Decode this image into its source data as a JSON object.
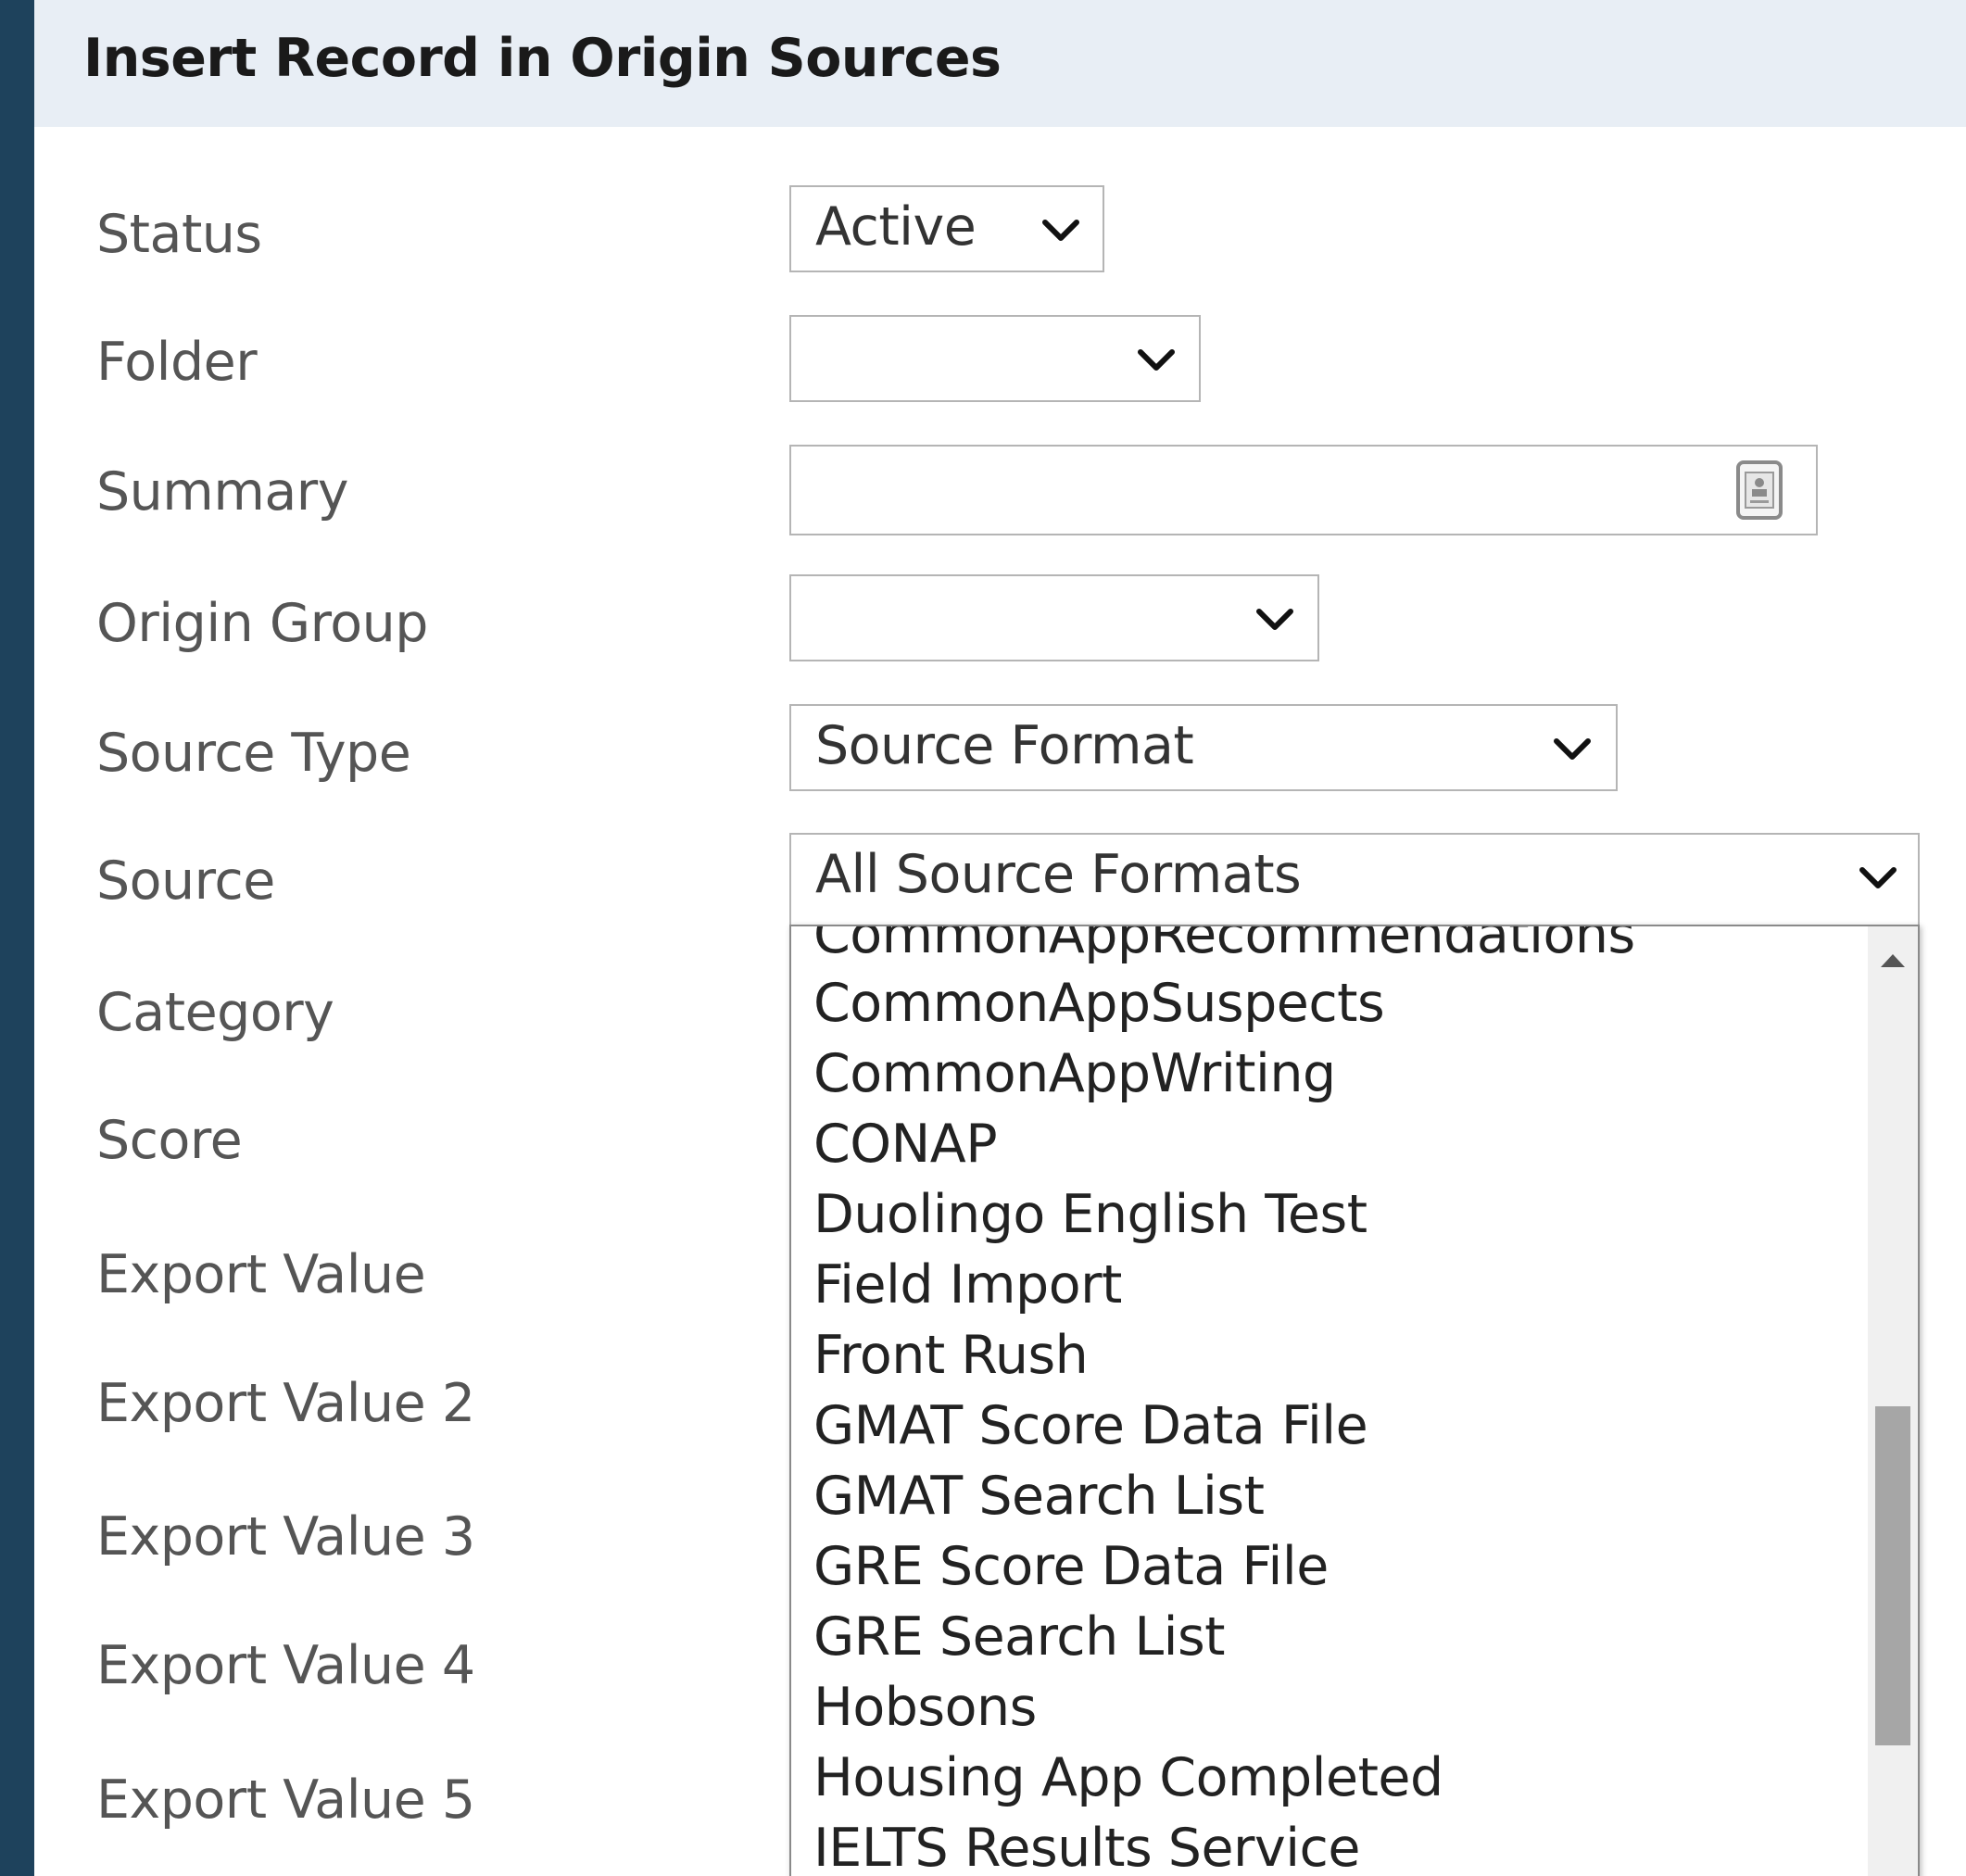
{
  "dialog": {
    "title": "Insert Record in Origin Sources"
  },
  "fields": {
    "status": {
      "label": "Status",
      "value": "Active"
    },
    "folder": {
      "label": "Folder",
      "value": ""
    },
    "summary": {
      "label": "Summary",
      "value": ""
    },
    "origin_group": {
      "label": "Origin Group",
      "value": ""
    },
    "source_type": {
      "label": "Source Type",
      "value": "Source Format"
    },
    "source": {
      "label": "Source",
      "value": "All Source Formats"
    },
    "category": {
      "label": "Category"
    },
    "score": {
      "label": "Score"
    },
    "export_value": {
      "label": "Export Value"
    },
    "export_value_2": {
      "label": "Export Value 2"
    },
    "export_value_3": {
      "label": "Export Value 3"
    },
    "export_value_4": {
      "label": "Export Value 4"
    },
    "export_value_5": {
      "label": "Export Value 5"
    }
  },
  "source_options": [
    "CommonAppRecommendations",
    "CommonAppSuspects",
    "CommonAppWriting",
    "CONAP",
    "Duolingo English Test",
    "Field Import",
    "Front Rush",
    "GMAT Score Data File",
    "GMAT Search List",
    "GRE Score Data File",
    "GRE Search List",
    "Hobsons",
    "Housing App Completed",
    "IELTS Results Service"
  ],
  "icons": {
    "chevron": "chevron-down-icon",
    "summary": "contact-card-icon",
    "scroll_up": "scroll-up-arrow-icon"
  },
  "colors": {
    "page_background": "#1e425c",
    "title_bar": "#e8eef5",
    "label_text": "#555555",
    "border": "#b5b5b5",
    "scroll_thumb": "#a6a6a6"
  }
}
